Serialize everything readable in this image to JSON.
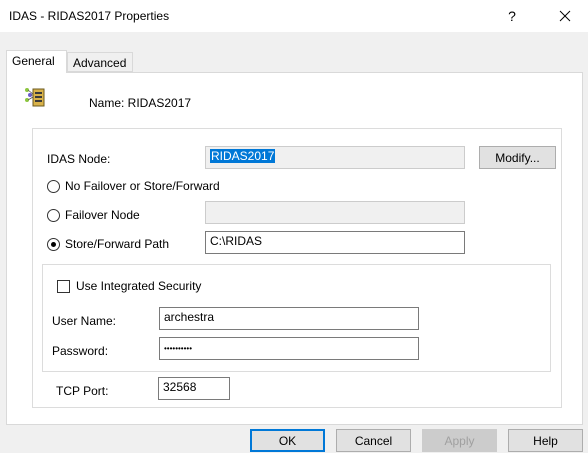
{
  "window": {
    "title": "IDAS - RIDAS2017 Properties",
    "help_label": "?",
    "close_label": "×"
  },
  "tabs": [
    {
      "label": "General",
      "active": true
    },
    {
      "label": "Advanced",
      "active": false
    }
  ],
  "general": {
    "name_label": "Name: RIDAS2017",
    "idas_node_label": "IDAS Node:",
    "idas_node_value": "RIDAS2017",
    "modify_label": "Modify...",
    "options": [
      {
        "label": "No Failover or Store/Forward",
        "selected": false
      },
      {
        "label": "Failover Node",
        "selected": false
      },
      {
        "label": "Store/Forward Path",
        "selected": true
      }
    ],
    "failover_node_value": "",
    "store_forward_path_value": "C:\\RIDAS",
    "use_integrated_security_label": "Use Integrated Security",
    "use_integrated_security_checked": false,
    "user_name_label": "User Name:",
    "user_name_value": "archestra",
    "password_label": "Password:",
    "password_value": "••••••••••",
    "tcp_port_label": "TCP Port:",
    "tcp_port_value": "32568"
  },
  "footer": {
    "ok_label": "OK",
    "cancel_label": "Cancel",
    "apply_label": "Apply",
    "help_label": "Help"
  },
  "colors": {
    "selection": "#0078d7",
    "dialog_bg": "#f0f0f0",
    "panel_bg": "#ffffff"
  }
}
